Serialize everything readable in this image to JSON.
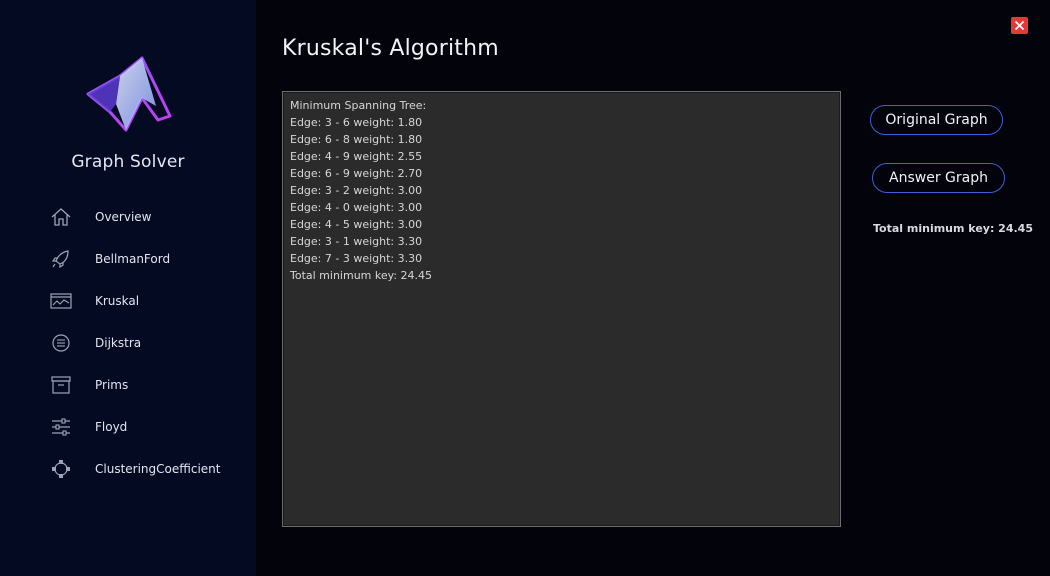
{
  "app": {
    "title": "Graph Solver"
  },
  "sidebar": {
    "items": [
      {
        "label": "Overview",
        "icon": "home-icon"
      },
      {
        "label": "BellmanFord",
        "icon": "rocket-icon"
      },
      {
        "label": "Kruskal",
        "icon": "chart-window-icon"
      },
      {
        "label": "Dijkstra",
        "icon": "circle-list-icon"
      },
      {
        "label": "Prims",
        "icon": "archive-box-icon"
      },
      {
        "label": "Floyd",
        "icon": "sliders-icon"
      },
      {
        "label": "ClusteringCoefficient",
        "icon": "network-icon"
      }
    ]
  },
  "main": {
    "title": "Kruskal's Algorithm",
    "result_lines": [
      "Minimum Spanning Tree:",
      "Edge: 3 - 6 weight: 1.80",
      "Edge: 6 - 8 weight: 1.80",
      "Edge: 4 - 9 weight: 2.55",
      "Edge: 6 - 9 weight: 2.70",
      "Edge: 3 - 2 weight: 3.00",
      "Edge: 4 - 0 weight: 3.00",
      "Edge: 4 - 5 weight: 3.00",
      "Edge: 3 - 1 weight: 3.30",
      "Edge: 7 - 3 weight: 3.30",
      "Total minimum key: 24.45"
    ],
    "buttons": {
      "original_graph": "Original Graph",
      "answer_graph": "Answer Graph"
    },
    "total_label": "Total minimum key: 24.45"
  },
  "colors": {
    "accent_border": "#3f5fd6",
    "close_button": "#e53935",
    "sidebar_bg": "#050a23",
    "main_bg": "#03030c",
    "result_bg": "#2b2b2b"
  }
}
